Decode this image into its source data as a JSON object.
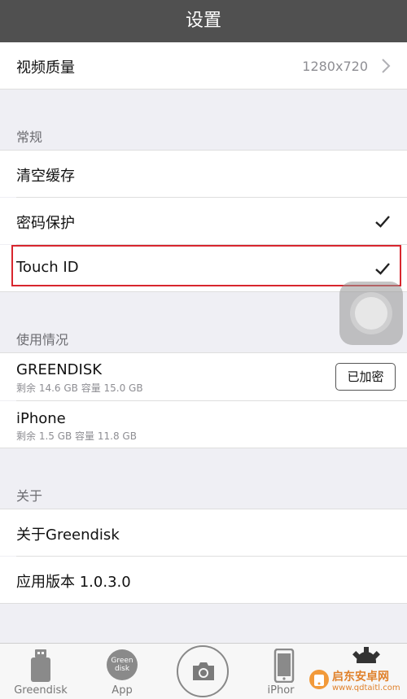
{
  "navbar": {
    "title": "设置"
  },
  "video_quality": {
    "label": "视频质量",
    "value": "1280x720"
  },
  "general": {
    "header": "常规",
    "clear_cache": "清空缓存",
    "password_protection": "密码保护",
    "touch_id": "Touch ID"
  },
  "usage": {
    "header": "使用情况",
    "greendisk": {
      "name": "GREENDISK",
      "detail": "剩余 14.6 GB 容量 15.0 GB",
      "button": "已加密"
    },
    "iphone": {
      "name": "iPhone",
      "detail": "剩余 1.5 GB 容量 11.8 GB"
    }
  },
  "about": {
    "header": "关于",
    "about_app": "关于Greendisk",
    "app_version": "应用版本 1.0.3.0"
  },
  "tabbar": {
    "greendisk": "Greendisk",
    "app": "App",
    "app_icon_text": "Green disk",
    "iphone": "iPhor"
  },
  "watermark": {
    "name": "启东安卓网",
    "url": "www.qdtaitl.com"
  },
  "colors": {
    "navbar": "#505050",
    "highlight": "#d8262e",
    "background": "#efeff4"
  }
}
